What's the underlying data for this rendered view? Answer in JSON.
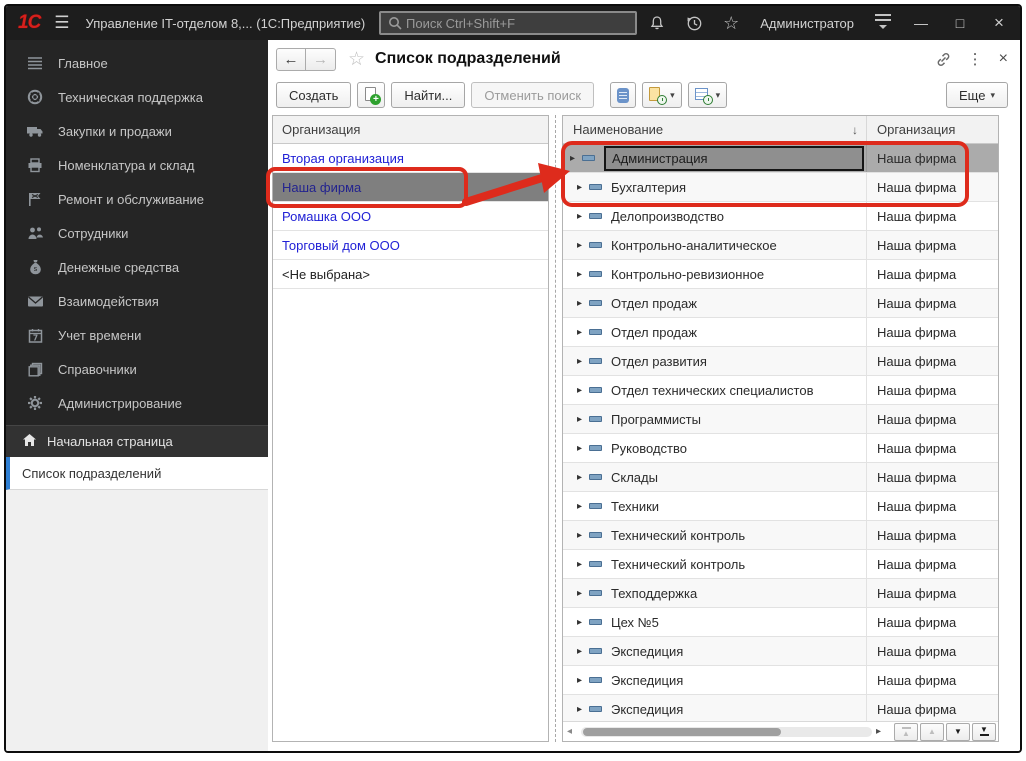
{
  "colors": {
    "annotation_red": "#de2b1c",
    "accent_blue": "#2e7fd4",
    "link_blue": "#2121d6",
    "selection_grey": "#7f7f7f"
  },
  "titlebar": {
    "logo": "1С",
    "app_title": "Управление IT-отделом 8,...  (1С:Предприятие)",
    "search_placeholder": "Поиск Ctrl+Shift+F",
    "user": "Администратор"
  },
  "icons": {
    "hamburger": "☰",
    "titlebar_star": "☆",
    "minimize": "—",
    "maximize": "□",
    "close": "×",
    "back": "←",
    "forward": "→",
    "favorite_star": "☆",
    "more_vertical": "⋮",
    "window_close": "×",
    "dropdown": "▾",
    "sort_desc": "↓",
    "expand_triangle": "▸",
    "scroll_left": "◂",
    "scroll_right": "▸",
    "page_up": "▲",
    "page_down": "▼"
  },
  "sidebar": {
    "items": [
      {
        "label": "Главное",
        "icon": "main-menu-icon"
      },
      {
        "label": "Техническая поддержка",
        "icon": "lifebuoy-icon"
      },
      {
        "label": "Закупки и продажи",
        "icon": "truck-icon"
      },
      {
        "label": "Номенклатура и склад",
        "icon": "printer-icon"
      },
      {
        "label": "Ремонт и обслуживание",
        "icon": "repair-flag-icon"
      },
      {
        "label": "Сотрудники",
        "icon": "people-icon"
      },
      {
        "label": "Денежные средства",
        "icon": "money-bag-icon"
      },
      {
        "label": "Взаимодействия",
        "icon": "envelope-icon"
      },
      {
        "label": "Учет времени",
        "icon": "calendar-icon"
      },
      {
        "label": "Справочники",
        "icon": "books-icon"
      },
      {
        "label": "Администрирование",
        "icon": "gear-icon"
      }
    ],
    "home_item": "Начальная страница",
    "open_tab": "Список подразделений"
  },
  "page": {
    "title": "Список подразделений",
    "toolbar": {
      "create": "Создать",
      "find": "Найти...",
      "cancel_search": "Отменить поиск",
      "more": "Еще"
    }
  },
  "org_panel": {
    "header": "Организация",
    "rows": [
      {
        "label": "Вторая организация",
        "style": "link"
      },
      {
        "label": "Наша фирма",
        "style": "selected"
      },
      {
        "label": "Ромашка ООО",
        "style": "link"
      },
      {
        "label": "Торговый дом ООО",
        "style": "link"
      },
      {
        "label": "<Не выбрана>",
        "style": "plain"
      }
    ]
  },
  "table": {
    "columns": {
      "name": "Наименование",
      "org": "Организация"
    },
    "rows": [
      {
        "name": "Администрация",
        "org": "Наша фирма",
        "selected": true
      },
      {
        "name": "Бухгалтерия",
        "org": "Наша фирма"
      },
      {
        "name": "Делопроизводство",
        "org": "Наша фирма"
      },
      {
        "name": "Контрольно-аналитическое",
        "org": "Наша фирма"
      },
      {
        "name": "Контрольно-ревизионное",
        "org": "Наша фирма"
      },
      {
        "name": "Отдел продаж",
        "org": "Наша фирма"
      },
      {
        "name": "Отдел продаж",
        "org": "Наша фирма"
      },
      {
        "name": "Отдел развития",
        "org": "Наша фирма"
      },
      {
        "name": "Отдел технических специалистов",
        "org": "Наша фирма"
      },
      {
        "name": "Программисты",
        "org": "Наша фирма"
      },
      {
        "name": "Руководство",
        "org": "Наша фирма"
      },
      {
        "name": "Склады",
        "org": "Наша фирма"
      },
      {
        "name": "Техники",
        "org": "Наша фирма"
      },
      {
        "name": "Технический контроль",
        "org": "Наша фирма"
      },
      {
        "name": "Технический контроль",
        "org": "Наша фирма"
      },
      {
        "name": "Техподдержка",
        "org": "Наша фирма"
      },
      {
        "name": "Цех №5",
        "org": "Наша фирма"
      },
      {
        "name": "Экспедиция",
        "org": "Наша фирма"
      },
      {
        "name": "Экспедиция",
        "org": "Наша фирма"
      },
      {
        "name": "Экспедиция",
        "org": "Наша фирма"
      }
    ]
  }
}
